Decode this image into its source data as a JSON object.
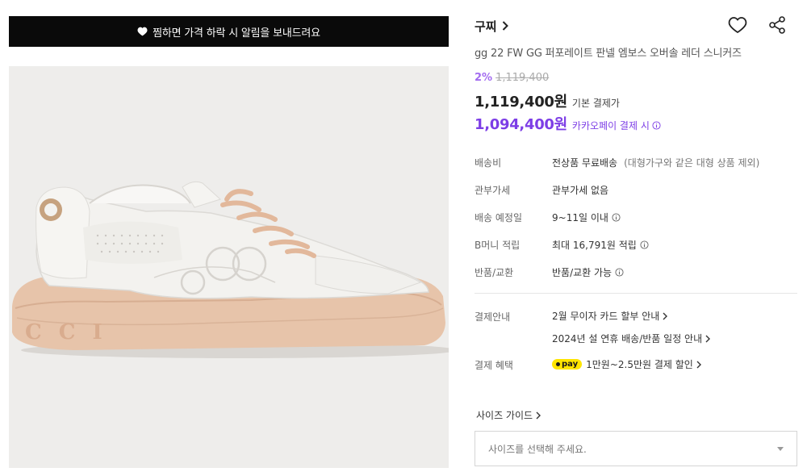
{
  "banner": {
    "text": "찜하면 가격 하락 시 알림을 보내드려요",
    "icon": "heart-icon"
  },
  "product": {
    "image_alt": "gucci sneaker",
    "brand": "구찌",
    "title": "gg 22 FW GG 퍼포레이트 판넬 엠보스 오버솔 레더 스니커즈",
    "discount_rate": "2%",
    "original_price": "1,119,400",
    "base_price": "1,119,400원",
    "base_price_label": "기본 결제가",
    "kakao_price": "1,094,400원",
    "kakao_price_label": "카카오페이 결제 시"
  },
  "info": [
    {
      "label": "배송비",
      "value": "전상품 무료배송",
      "note": "(대형가구와 같은 대형 상품 제외)"
    },
    {
      "label": "관부가세",
      "value": "관부가세 없음"
    },
    {
      "label": "배송 예정일",
      "value": "9~11일 이내"
    },
    {
      "label": "B머니 적립",
      "value": "최대 16,791원 적립"
    },
    {
      "label": "반품/교환",
      "value": "반품/교환 가능"
    }
  ],
  "payment": {
    "guide_label": "결제안내",
    "guide_links": [
      "2월 무이자 카드 할부 안내",
      "2024년 설 연휴 배송/반품 일정 안내"
    ],
    "benefit_label": "결제 혜택",
    "benefit_badge": "pay",
    "benefit_text": "1만원~2.5만원 결제 할인"
  },
  "size": {
    "guide_label": "사이즈 가이드",
    "select_placeholder": "사이즈를 선택해 주세요."
  },
  "colors": {
    "accent_purple": "#7d3ee6",
    "discount_purple": "#a36cf0",
    "kakao_yellow": "#fee500",
    "banner_bg": "#0a0a0a"
  }
}
